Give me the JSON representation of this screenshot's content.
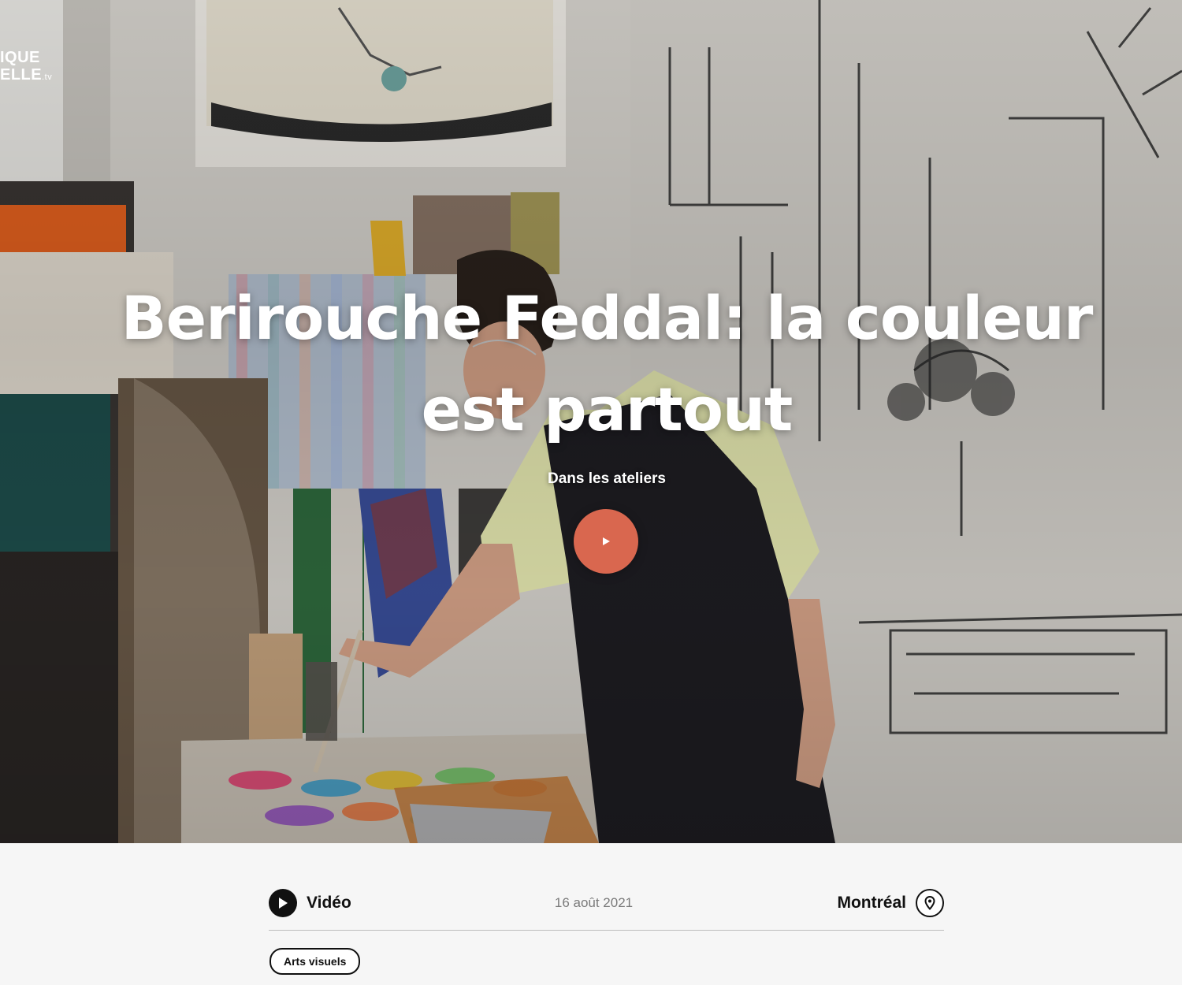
{
  "site": {
    "logo_line1": "IQUE",
    "logo_line2": "ELLE",
    "logo_suffix": ".tv"
  },
  "hero": {
    "title": "Berirouche Feddal: la couleur est partout",
    "subtitle": "Dans les ateliers",
    "play_icon": "play-icon"
  },
  "meta": {
    "type_label": "Vidéo",
    "type_icon": "play-circle-icon",
    "date": "16 août 2021",
    "location": "Montréal",
    "location_icon": "map-pin-icon"
  },
  "tags": [
    "Arts visuels"
  ],
  "colors": {
    "accent": "#d9674f",
    "text_dark": "#111111",
    "text_muted": "#7a7a7a",
    "page_bg": "#f6f6f6"
  }
}
